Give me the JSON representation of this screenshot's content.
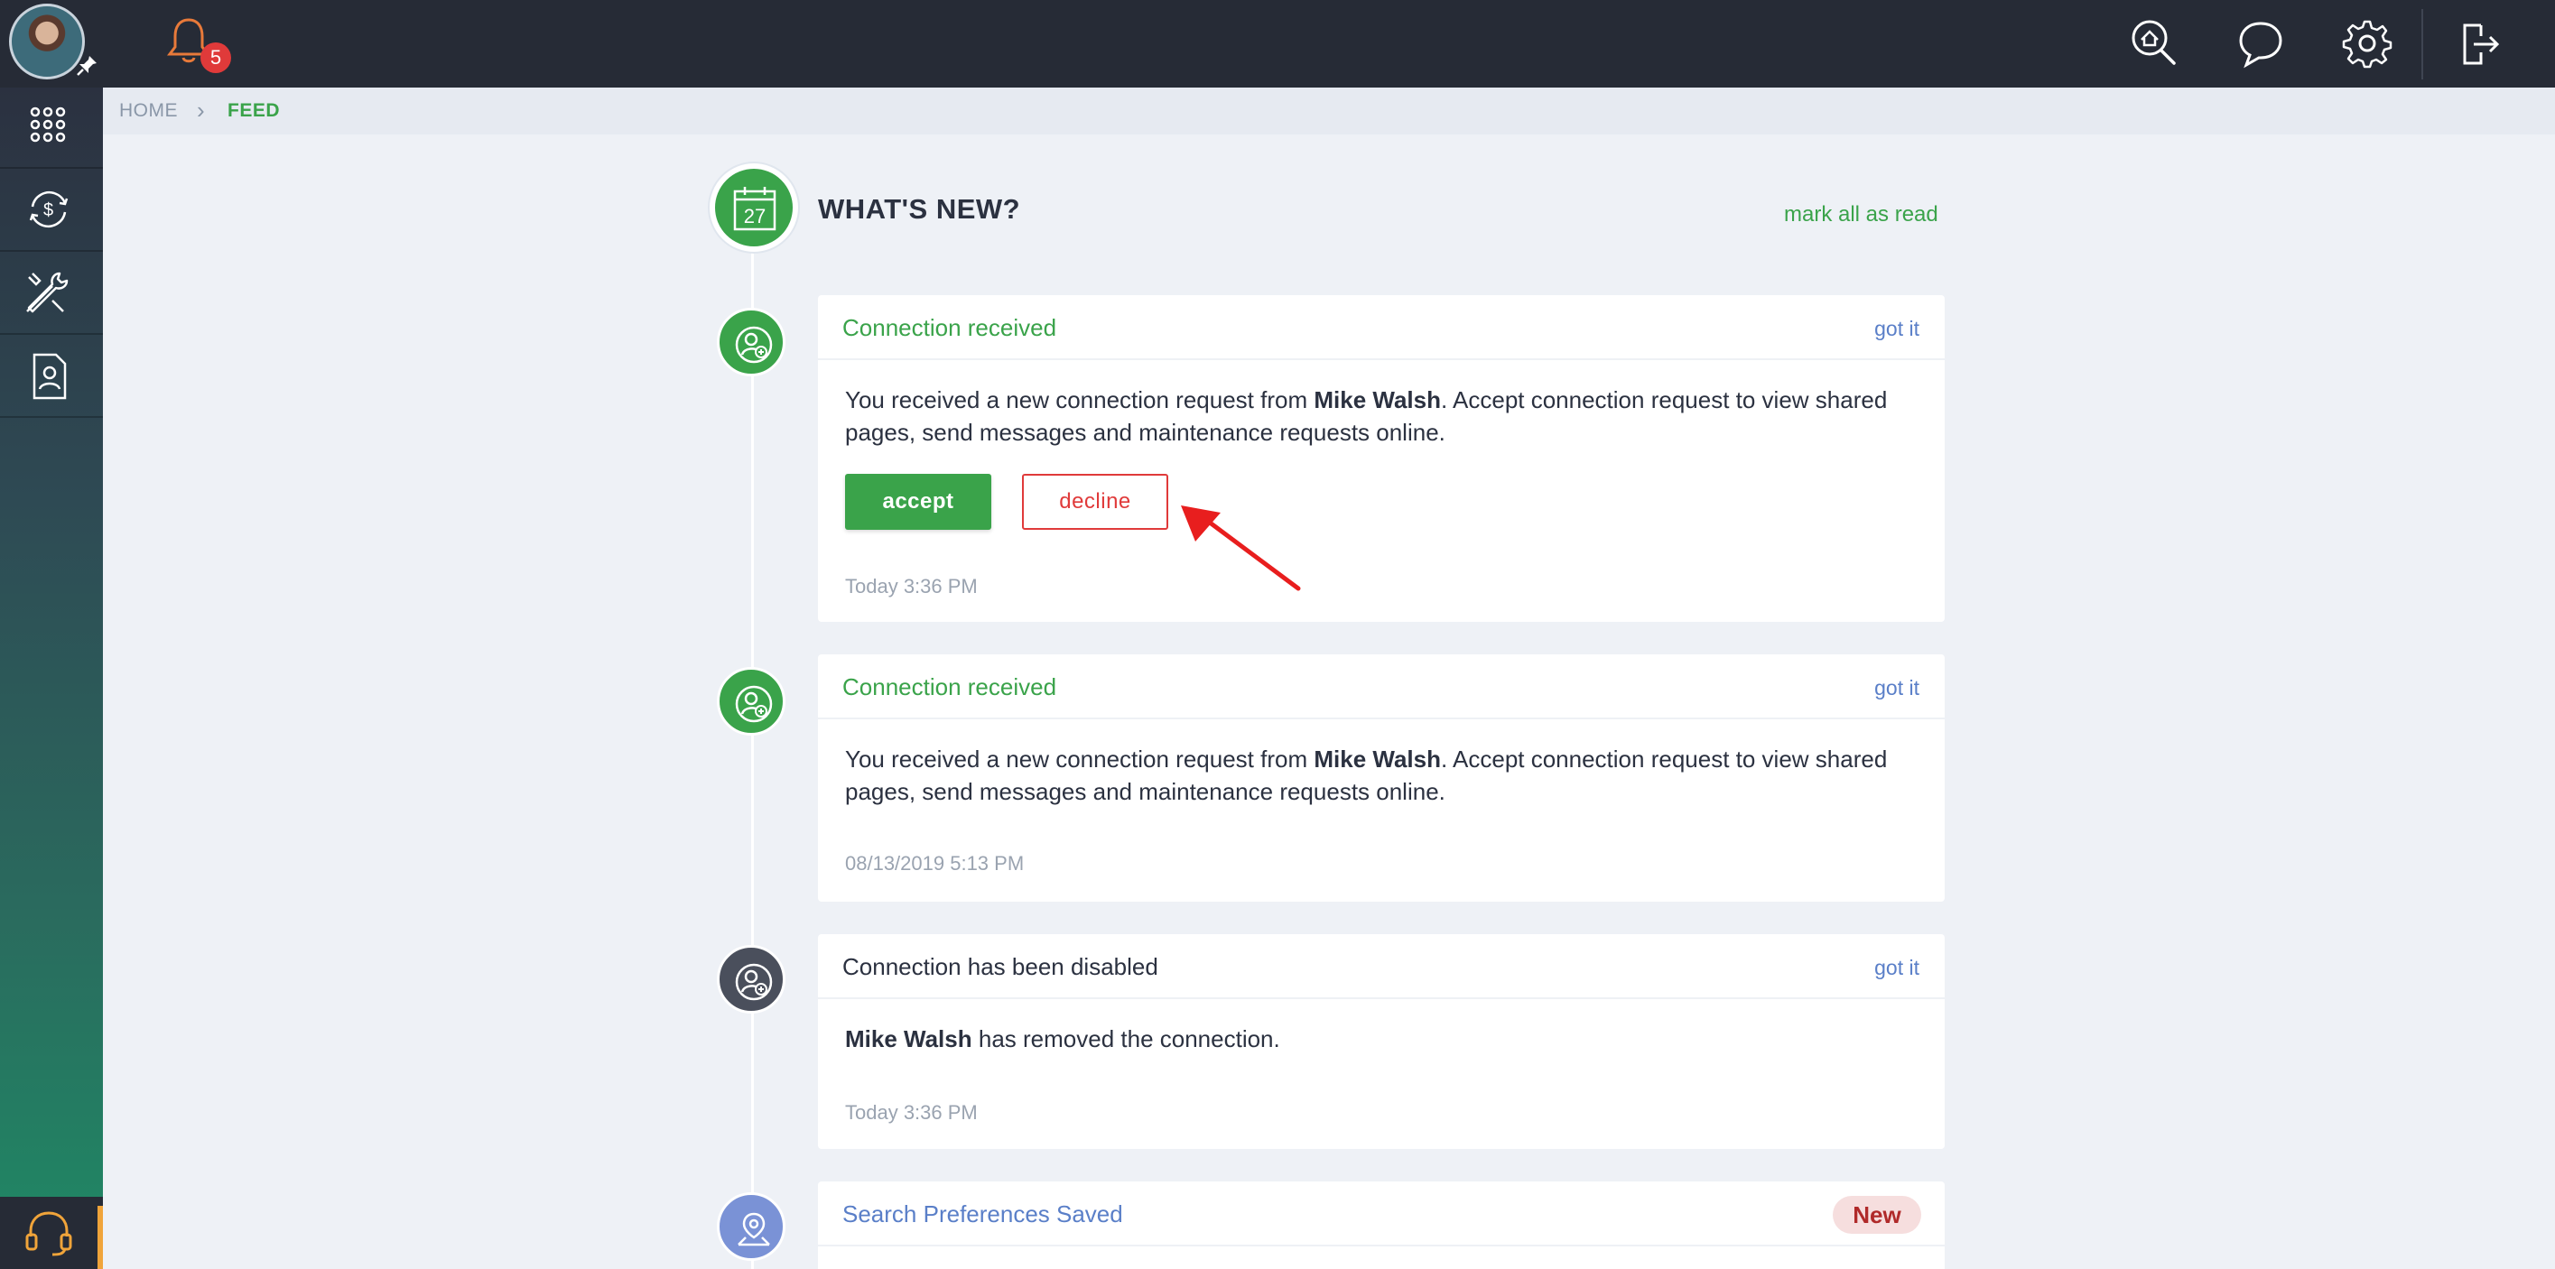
{
  "topbar": {
    "notification_count": "5",
    "icons": [
      "search-home-icon",
      "chat-icon",
      "gear-icon",
      "logout-icon"
    ]
  },
  "sidebar": {
    "items": [
      "apps-grid-icon",
      "payments-icon",
      "maintenance-tools-icon",
      "contact-document-icon"
    ],
    "support": "headset-icon"
  },
  "breadcrumb": {
    "home": "HOME",
    "current": "FEED"
  },
  "feed": {
    "title": "WHAT'S NEW?",
    "calendar_day": "27",
    "mark_all_read": "mark all as read",
    "items": [
      {
        "title": "Connection received",
        "action": "got it",
        "text_before": "You received a new connection request from ",
        "name": "Mike Walsh",
        "text_after": ". Accept connection request to view shared pages, send messages and maintenance requests online.",
        "accept": "accept",
        "decline": "decline",
        "time": "Today 3:36 PM"
      },
      {
        "title": "Connection received",
        "action": "got it",
        "text_before": "You received a new connection request from ",
        "name": "Mike Walsh",
        "text_after": ". Accept connection request to view shared pages, send messages and maintenance requests online.",
        "time": "08/13/2019 5:13 PM"
      },
      {
        "title": "Connection has been disabled",
        "action": "got it",
        "name": "Mike Walsh",
        "text_after": " has removed the connection.",
        "time": "Today 3:36 PM"
      },
      {
        "title": "Search Preferences Saved",
        "badge": "New"
      }
    ]
  },
  "colors": {
    "accent_green": "#3aa34a",
    "danger_red": "#e03a3a",
    "link_blue": "#5a7fc8",
    "topbar": "#262b36"
  }
}
